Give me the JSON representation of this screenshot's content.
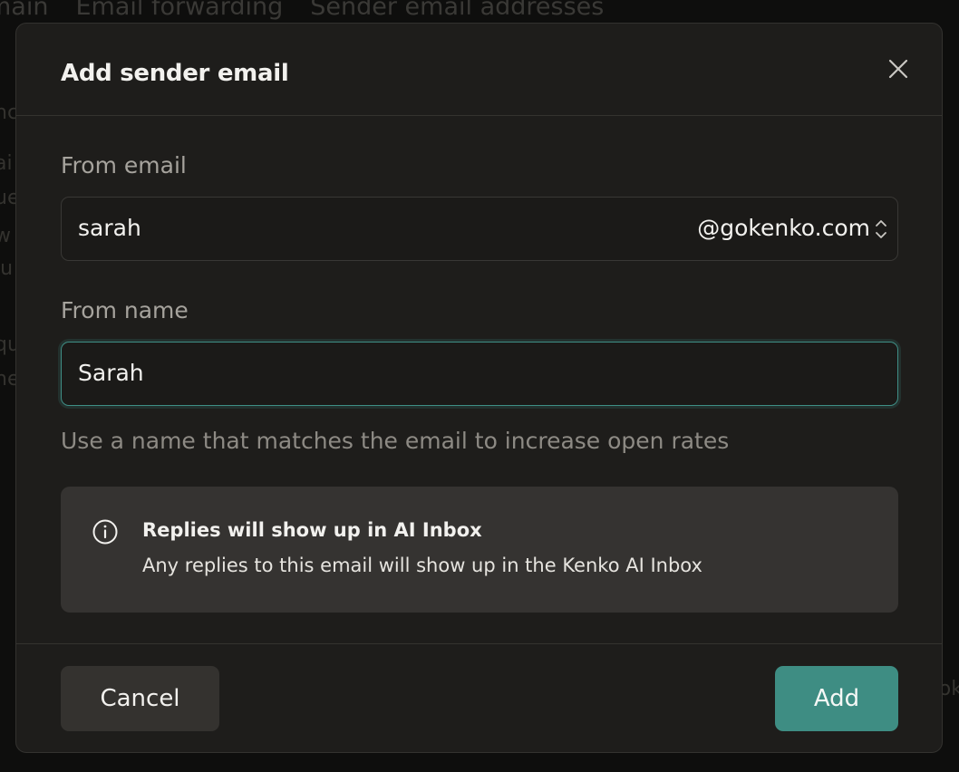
{
  "background": {
    "tabs": [
      "main",
      "Email forwarding",
      "Sender email addresses"
    ],
    "fragments": [
      "nc",
      "ai",
      "ue",
      "w",
      "iu",
      "qu",
      "ne"
    ],
    "right_fragment": "ok"
  },
  "modal": {
    "title": "Add sender email",
    "close_icon": "close-icon",
    "from_email": {
      "label": "From email",
      "value": "sarah",
      "domain": "@gokenko.com",
      "chevron_icon": "chevron-up-down-icon"
    },
    "from_name": {
      "label": "From name",
      "value": "Sarah",
      "hint": "Use a name that matches the email to increase open rates"
    },
    "notice": {
      "icon": "info-icon",
      "title": "Replies will show up in AI Inbox",
      "body": "Any replies to this email will show up in the Kenko AI Inbox"
    },
    "buttons": {
      "cancel": "Cancel",
      "add": "Add"
    }
  },
  "colors": {
    "accent": "#3e8d83",
    "modal_bg": "#1e1d1b",
    "notice_bg": "#353331"
  }
}
